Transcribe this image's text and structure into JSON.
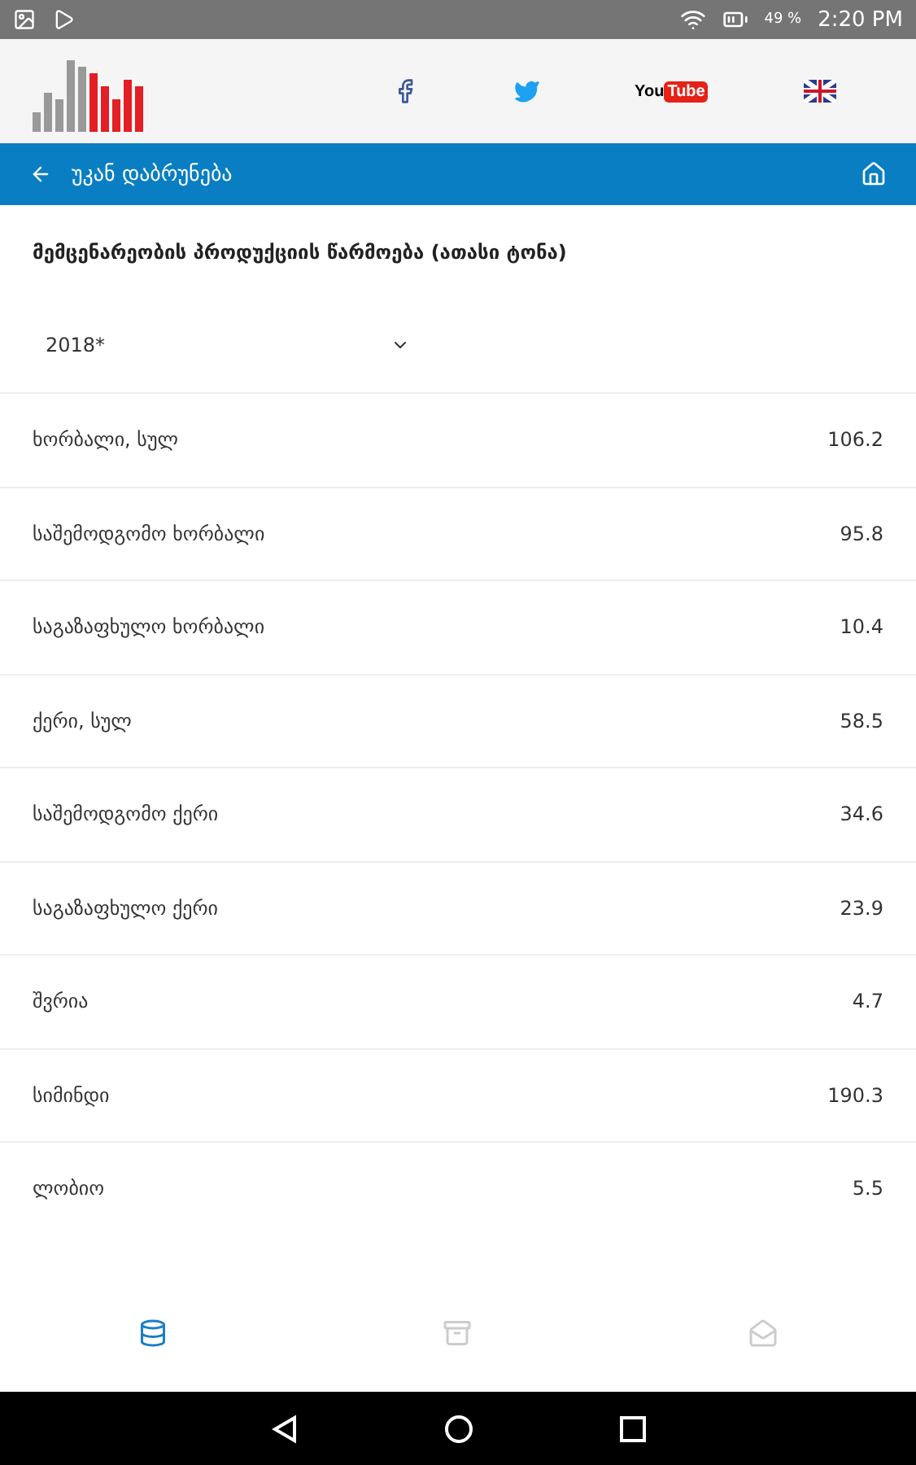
{
  "status_bar": {
    "battery": "49 %",
    "time": "2:20 PM"
  },
  "header": {
    "youtube_logo": {
      "left": "You",
      "right": "Tube"
    }
  },
  "nav_bar": {
    "back_label": "უკან დაბრუნება"
  },
  "title": "მემცენარეობის პროდუქციის წარმოება (ათასი ტონა)",
  "year_select": {
    "value": "2018*"
  },
  "rows": [
    {
      "label": "ხორბალი, სულ",
      "value": "106.2"
    },
    {
      "label": "საშემოდგომო ხორბალი",
      "value": "95.8"
    },
    {
      "label": "საგაზაფხულო ხორბალი",
      "value": "10.4"
    },
    {
      "label": "ქერი, სულ",
      "value": "58.5"
    },
    {
      "label": "საშემოდგომო ქერი",
      "value": "34.6"
    },
    {
      "label": "საგაზაფხულო ქერი",
      "value": "23.9"
    },
    {
      "label": "შვრია",
      "value": "4.7"
    },
    {
      "label": "სიმინდი",
      "value": "190.3"
    },
    {
      "label": "ლობიო",
      "value": "5.5"
    }
  ],
  "bottom_tabs": [
    {
      "kind": "data",
      "selected": true
    },
    {
      "kind": "archive",
      "selected": false
    },
    {
      "kind": "mail",
      "selected": false
    }
  ]
}
